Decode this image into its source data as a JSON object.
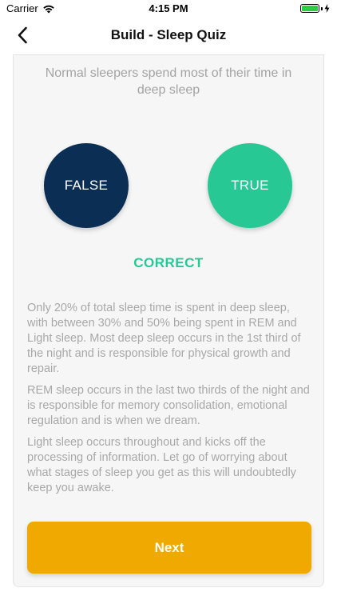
{
  "status_bar": {
    "carrier": "Carrier",
    "time": "4:15 PM",
    "wifi_icon": "wifi-icon",
    "battery_icon": "battery-icon",
    "charging_icon": "charging-bolt-icon"
  },
  "nav": {
    "title": "Build - Sleep Quiz",
    "back_icon": "chevron-left-icon"
  },
  "quiz": {
    "question": "Normal sleepers spend most of their time in deep sleep",
    "answers": {
      "false_label": "FALSE",
      "true_label": "TRUE"
    },
    "result": "CORRECT",
    "explanation": [
      "Only 20% of total sleep time is spent in deep sleep, with between 30% and 50% being spent in REM and Light sleep. Most deep sleep occurs in the 1st third of the night and is responsible for physical growth and repair.",
      " REM sleep occurs in the last two thirds of the night and is responsible for memory consolidation, emotional regulation and is when we dream.",
      " Light sleep occurs throughout and kicks off the processing of information. Let go of worrying about what stages of sleep you get as this will undoubtedly keep you awake."
    ],
    "next_label": "Next"
  },
  "colors": {
    "false_button": "#0b2e55",
    "true_button": "#27c894",
    "result_text": "#27c894",
    "next_button": "#f0a900",
    "muted_text": "#a8a8a8"
  }
}
